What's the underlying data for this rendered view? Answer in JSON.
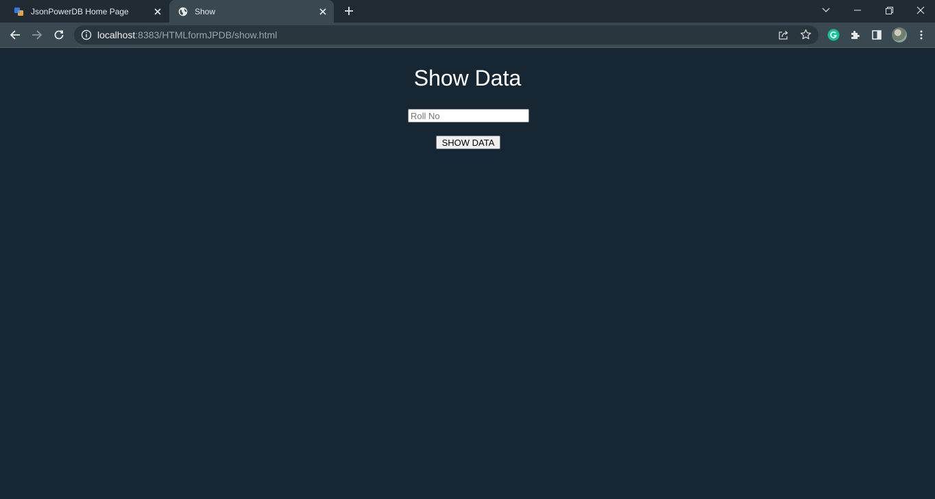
{
  "browser": {
    "tabs": [
      {
        "title": "JsonPowerDB Home Page",
        "favicon": "jpdb-logo-icon",
        "active": false
      },
      {
        "title": "Show",
        "favicon": "globe-icon",
        "active": true
      }
    ],
    "url": {
      "host": "localhost",
      "rest": ":8383/HTMLformJPDB/show.html"
    },
    "colors": {
      "tabstrip": "#202b33",
      "toolbar": "#3a4852",
      "omnibox": "#2a363e"
    }
  },
  "page": {
    "title": "Show Data",
    "rollno_placeholder": "Roll No",
    "rollno_value": "",
    "button_label": "SHOW DATA",
    "background": "#162633"
  }
}
